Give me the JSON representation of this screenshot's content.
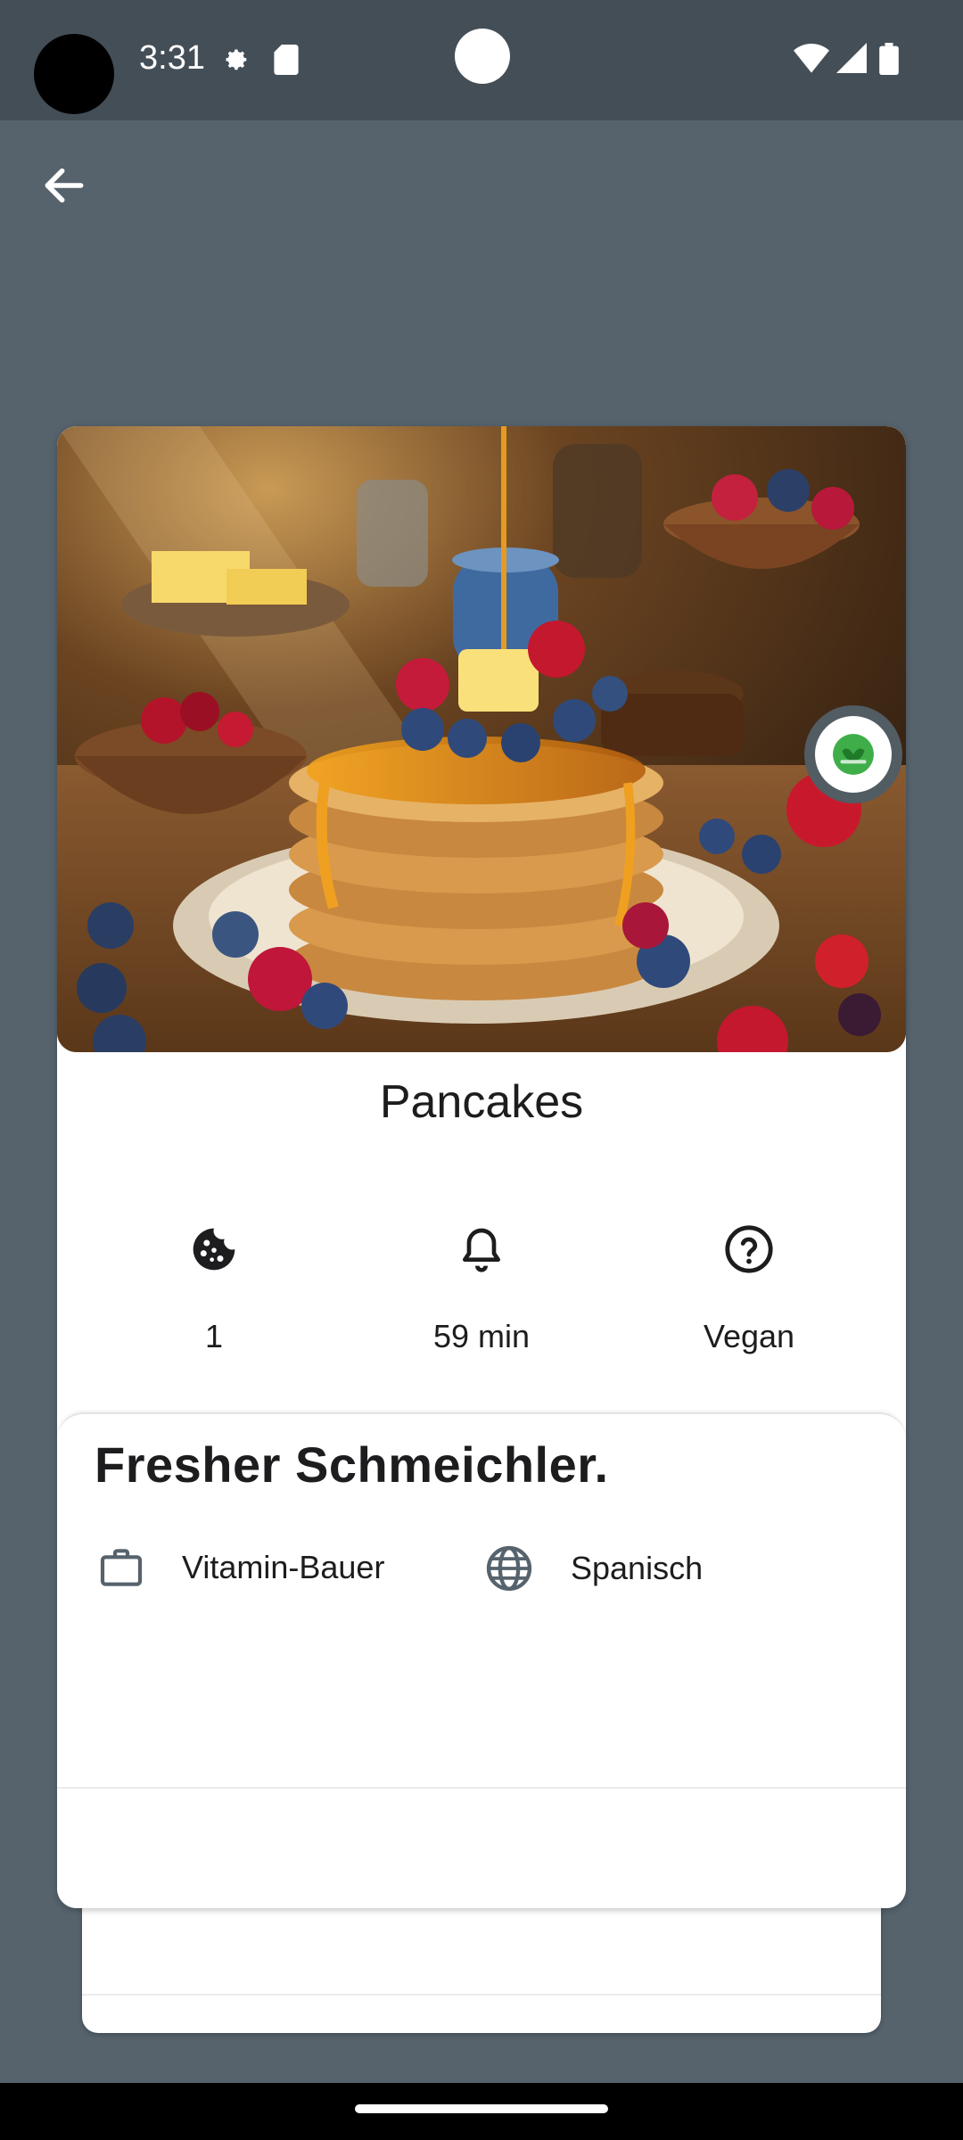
{
  "status_bar": {
    "time": "3:31",
    "icons": [
      "settings-gear-icon",
      "sd-card-icon",
      "wifi-icon",
      "signal-icon",
      "battery-icon"
    ]
  },
  "toolbar": {
    "back_icon": "arrow-left-icon"
  },
  "recipe": {
    "title": "Pancakes",
    "image_alt": "Stack of pancakes with syrup, butter and berries",
    "badge_icon": "vegan-leaf-icon",
    "stats": [
      {
        "icon": "cookie-icon",
        "value": "1"
      },
      {
        "icon": "bell-icon",
        "value": "59 min"
      },
      {
        "icon": "help-circle-icon",
        "value": "Vegan"
      }
    ]
  },
  "info": {
    "brand": "Fresher Schmeichler.",
    "company_icon": "briefcase-icon",
    "company": "Vitamin-Bauer",
    "cuisine_icon": "globe-icon",
    "cuisine": "Spanisch"
  },
  "colors": {
    "background": "#56636d",
    "status_bar": "#444e56",
    "badge_green": "#3fae49"
  }
}
